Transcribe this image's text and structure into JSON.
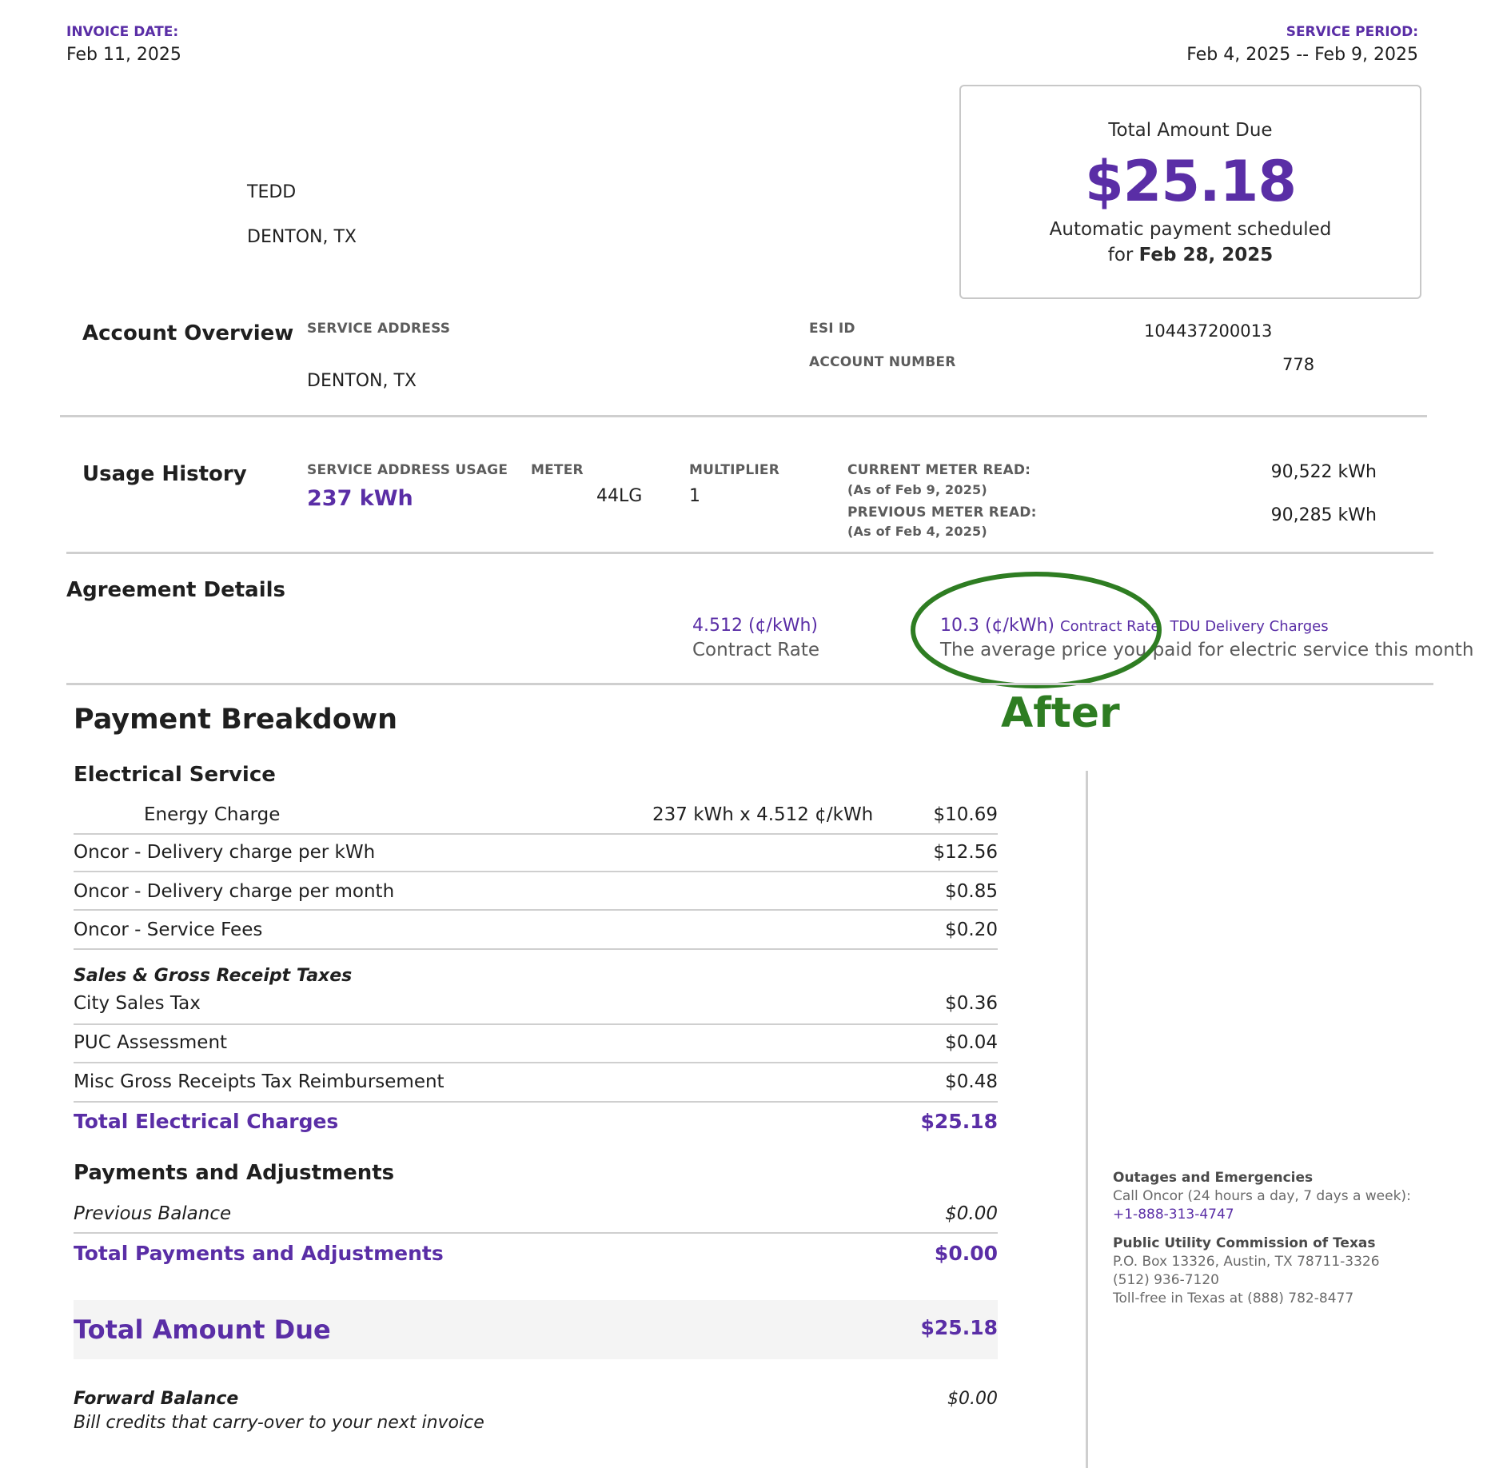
{
  "header": {
    "invoice_date_label": "INVOICE DATE:",
    "invoice_date": "Feb 11, 2025",
    "service_period_label": "SERVICE PERIOD:",
    "service_period": "Feb 4, 2025 -- Feb 9, 2025"
  },
  "customer": {
    "name": "TEDD",
    "city": "DENTON, TX"
  },
  "summary": {
    "label": "Total Amount Due",
    "amount": "$25.18",
    "autopay_text": "Automatic payment scheduled",
    "autopay_for": "for",
    "autopay_date": "Feb 28, 2025"
  },
  "account": {
    "title": "Account Overview",
    "service_address_label": "SERVICE ADDRESS",
    "service_address": "DENTON, TX",
    "esi_label": "ESI ID",
    "esi_value": "104437200013",
    "account_number_label": "ACCOUNT NUMBER",
    "account_number": "778"
  },
  "usage": {
    "title": "Usage History",
    "service_address_usage_label": "SERVICE ADDRESS USAGE",
    "service_address_usage": "237 kWh",
    "meter_label": "METER",
    "meter": "44LG",
    "multiplier_label": "MULTIPLIER",
    "multiplier": "1",
    "current_read_label": "CURRENT METER READ:",
    "current_read_date": "(As of Feb 9, 2025)",
    "current_read": "90,522 kWh",
    "previous_read_label": "PREVIOUS METER READ:",
    "previous_read_date": "(As of Feb 4, 2025)",
    "previous_read": "90,285 kWh"
  },
  "agreement": {
    "title": "Agreement Details",
    "rate_value": "4.512 (¢/kWh)",
    "rate_label": "Contract Rate",
    "avg_value": "10.3 (¢/kWh)",
    "avg_contract_rate": "Contract Rate",
    "avg_tdu": "TDU Delivery Charges",
    "avg_desc": "The average price you paid for electric service this month",
    "annotation": "After",
    "annotation_color": "#2e7d22"
  },
  "breakdown": {
    "title": "Payment Breakdown",
    "electrical_title": "Electrical Service",
    "energy_charge_label": "Energy Charge",
    "energy_charge_calc": "237 kWh x 4.512 ¢/kWh",
    "energy_charge_amount": "$10.69",
    "rows": [
      {
        "label": "Oncor - Delivery charge per kWh",
        "amount": "$12.56"
      },
      {
        "label": "Oncor - Delivery charge per month",
        "amount": "$0.85"
      },
      {
        "label": "Oncor - Service Fees",
        "amount": "$0.20"
      }
    ],
    "tax_title": "Sales & Gross Receipt Taxes",
    "tax_rows": [
      {
        "label": "City Sales Tax",
        "amount": "$0.36"
      },
      {
        "label": "PUC Assessment",
        "amount": "$0.04"
      },
      {
        "label": "Misc Gross Receipts Tax Reimbursement",
        "amount": "$0.48"
      }
    ],
    "total_electrical_label": "Total Electrical Charges",
    "total_electrical_amount": "$25.18",
    "payments_title": "Payments and Adjustments",
    "previous_balance_label": "Previous Balance",
    "previous_balance_amount": "$0.00",
    "total_payments_label": "Total Payments and Adjustments",
    "total_payments_amount": "$0.00",
    "total_due_label": "Total Amount Due",
    "total_due_amount": "$25.18",
    "forward_balance_label": "Forward Balance",
    "forward_balance_desc": "Bill credits that carry-over to your next invoice",
    "forward_balance_amount": "$0.00"
  },
  "contacts": {
    "outages_title": "Outages and Emergencies",
    "outages_text": "Call Oncor (24 hours a day, 7 days a week):",
    "outages_phone": "+1-888-313-4747",
    "puc_title": "Public Utility Commission of Texas",
    "puc_address": "P.O. Box 13326, Austin, TX 78711-3326",
    "puc_phone": "(512) 936-7120",
    "puc_tollfree": "Toll-free in Texas at (888) 782-8477"
  },
  "colors": {
    "brand": "#5a2ea6",
    "annotation": "#2e7d22"
  }
}
